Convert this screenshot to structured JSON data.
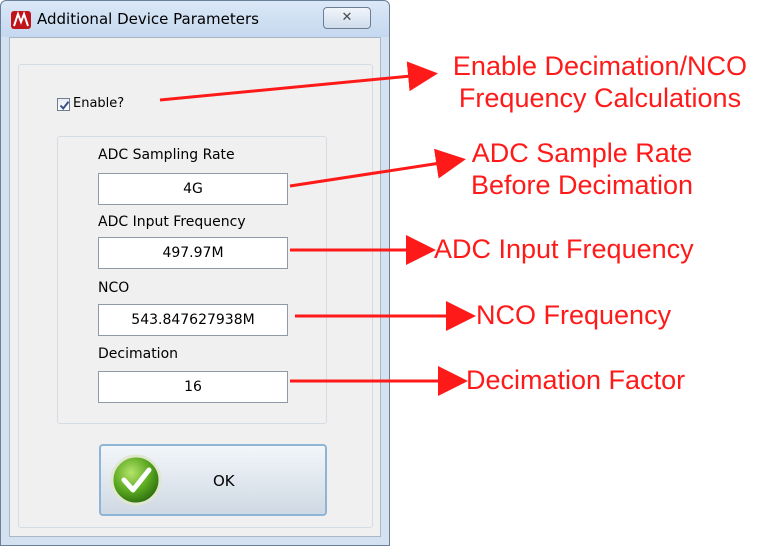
{
  "window": {
    "title": "Additional Device Parameters",
    "close_label": "✕"
  },
  "form": {
    "enable_label": "Enable?",
    "enable_checked": true,
    "adc_sampling_rate_label": "ADC Sampling Rate",
    "adc_sampling_rate_value": "4G",
    "adc_input_frequency_label": "ADC Input  Frequency",
    "adc_input_frequency_value": "497.97M",
    "nco_label": "NCO",
    "nco_value": "543.847627938M",
    "decimation_label": "Decimation",
    "decimation_value": "16",
    "ok_label": "OK"
  },
  "annotations": {
    "enable": [
      "Enable Decimation/NCO",
      "Frequency Calculations"
    ],
    "sample_rate": [
      "ADC Sample Rate",
      "Before Decimation"
    ],
    "input_frequency": "ADC Input Frequency",
    "nco": "NCO Frequency",
    "decimation": "Decimation Factor"
  },
  "colors": {
    "annotation": "#ff1a1a",
    "ok_check": "#5aa820",
    "title_bar": "#c5d8ef"
  }
}
